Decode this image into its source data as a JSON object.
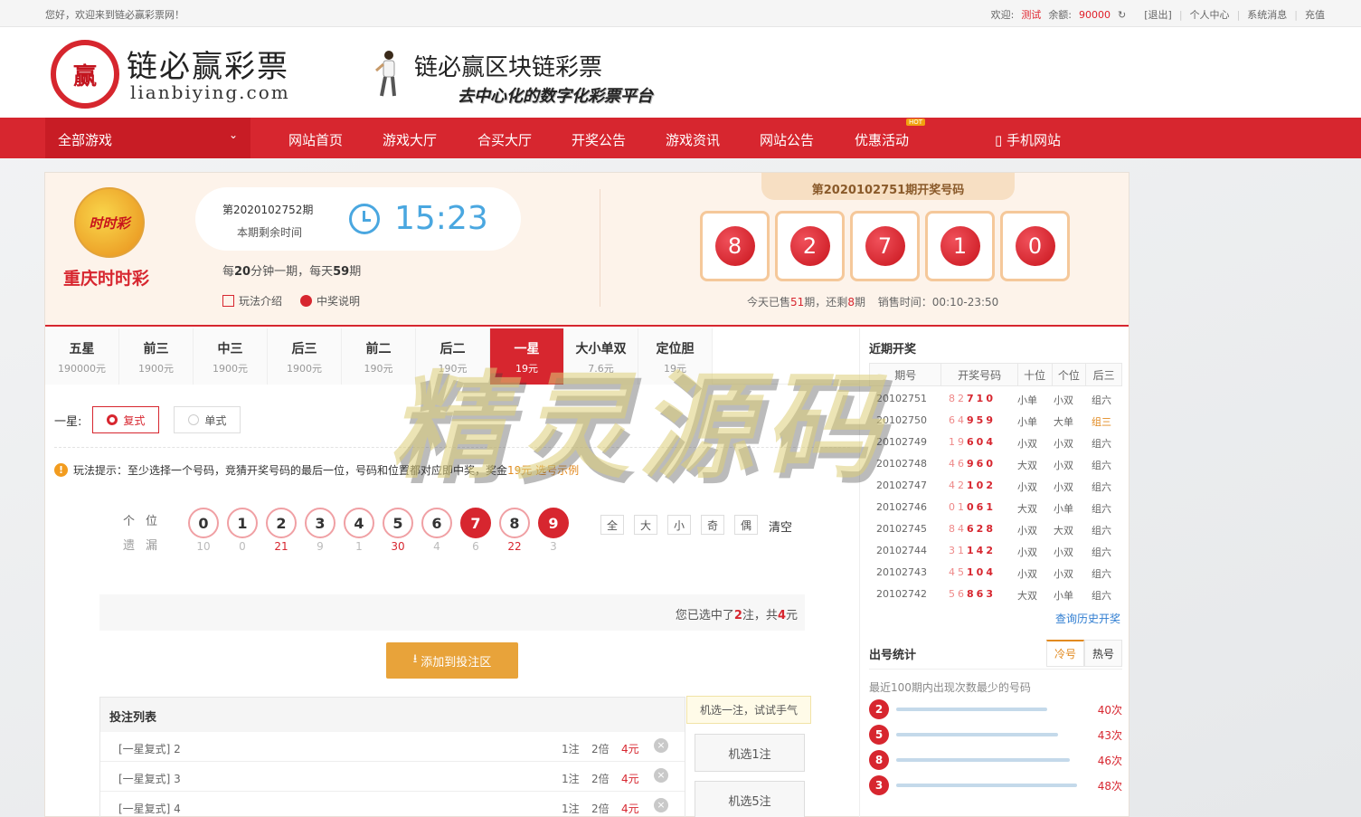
{
  "topbar": {
    "welcome": "您好，欢迎来到链必赢彩票网！",
    "greet_label": "欢迎:",
    "username": "测试",
    "balance_label": "余额:",
    "balance": "90000",
    "logout": "[退出]",
    "personal": "个人中心",
    "messages": "系统消息",
    "recharge": "充值"
  },
  "header": {
    "logo_mark": "赢",
    "logo_cn": "链必赢彩票",
    "logo_en": "lianbiying.com",
    "slogan_title": "链必赢区块链彩票",
    "slogan_sub": "去中心化的数字化彩票平台"
  },
  "nav": {
    "all_games": "全部游戏",
    "items": [
      "网站首页",
      "游戏大厅",
      "合买大厅",
      "开奖公告",
      "游戏资讯",
      "网站公告",
      "优惠活动"
    ],
    "hot": "HOT",
    "mobile": "手机网站"
  },
  "lottery": {
    "logo_text": "时时彩",
    "name": "重庆时时彩",
    "period": "第2020102752期",
    "remain_label": "本期剩余时间",
    "countdown": "15:23",
    "freq_a": "每",
    "freq_min": "20",
    "freq_b": "分钟一期，每天",
    "freq_count": "59",
    "freq_c": "期",
    "rules": "玩法介绍",
    "prize": "中奖说明",
    "draw_title": "第2020102751期开奖号码",
    "draw_balls": [
      "8",
      "2",
      "7",
      "1",
      "0"
    ],
    "sales_a": "今天已售",
    "sold": "51",
    "sales_b": "期，还剩",
    "left": "8",
    "sales_c": "期",
    "sales_time": "销售时间：00:10-23:50"
  },
  "tabs": [
    {
      "title": "五星",
      "prize": "190000元"
    },
    {
      "title": "前三",
      "prize": "1900元"
    },
    {
      "title": "中三",
      "prize": "1900元"
    },
    {
      "title": "后三",
      "prize": "1900元"
    },
    {
      "title": "前二",
      "prize": "190元"
    },
    {
      "title": "后二",
      "prize": "190元"
    },
    {
      "title": "一星",
      "prize": "19元"
    },
    {
      "title": "大小单双",
      "prize": "7.6元"
    },
    {
      "title": "定位胆",
      "prize": "19元"
    }
  ],
  "play": {
    "mode_label": "一星:",
    "mode_fushi": "复式",
    "mode_danshi": "单式",
    "tip_a": "玩法提示：至少选择一个号码，竞猜开奖号码的最后一位，号码和位置都对应即中奖，奖金",
    "tip_amount": "19元",
    "tip_example": "选号示例",
    "pos_label": "个位",
    "miss_label": "遗漏",
    "digits": [
      "0",
      "1",
      "2",
      "3",
      "4",
      "5",
      "6",
      "7",
      "8",
      "9"
    ],
    "misses": [
      "10",
      "0",
      "21",
      "9",
      "1",
      "30",
      "4",
      "6",
      "22",
      "3"
    ],
    "quick": [
      "全",
      "大",
      "小",
      "奇",
      "偶"
    ],
    "clear": "清空",
    "summary_a": "您已选中了",
    "summary_count": "2",
    "summary_b": "注，共",
    "summary_amount": "4",
    "summary_c": "元",
    "add_button": "添加到投注区"
  },
  "betlist": {
    "title": "投注列表",
    "rows": [
      {
        "name": "[一星复式] 2",
        "count": "1注",
        "mult": "2倍",
        "amount": "4元"
      },
      {
        "name": "[一星复式] 3",
        "count": "1注",
        "mult": "2倍",
        "amount": "4元"
      },
      {
        "name": "[一星复式] 4",
        "count": "1注",
        "mult": "2倍",
        "amount": "4元"
      }
    ],
    "try_luck": "机选一注，试试手气",
    "machine1": "机选1注",
    "machine5": "机选5注"
  },
  "recent": {
    "title": "近期开奖",
    "headers": [
      "期号",
      "开奖号码",
      "十位",
      "个位",
      "后三"
    ],
    "rows": [
      {
        "period": "20102751",
        "nums": [
          "8",
          "2",
          "7",
          "1",
          "0"
        ],
        "ten": "小单",
        "one": "小双",
        "last3": "组六"
      },
      {
        "period": "20102750",
        "nums": [
          "6",
          "4",
          "9",
          "5",
          "9"
        ],
        "ten": "小单",
        "one": "大单",
        "last3": "组三"
      },
      {
        "period": "20102749",
        "nums": [
          "1",
          "9",
          "6",
          "0",
          "4"
        ],
        "ten": "小双",
        "one": "小双",
        "last3": "组六"
      },
      {
        "period": "20102748",
        "nums": [
          "4",
          "6",
          "9",
          "6",
          "0"
        ],
        "ten": "大双",
        "one": "小双",
        "last3": "组六"
      },
      {
        "period": "20102747",
        "nums": [
          "4",
          "2",
          "1",
          "0",
          "2"
        ],
        "ten": "小双",
        "one": "小双",
        "last3": "组六"
      },
      {
        "period": "20102746",
        "nums": [
          "0",
          "1",
          "0",
          "6",
          "1"
        ],
        "ten": "大双",
        "one": "小单",
        "last3": "组六"
      },
      {
        "period": "20102745",
        "nums": [
          "8",
          "4",
          "6",
          "2",
          "8"
        ],
        "ten": "小双",
        "one": "大双",
        "last3": "组六"
      },
      {
        "period": "20102744",
        "nums": [
          "3",
          "1",
          "1",
          "4",
          "2"
        ],
        "ten": "小双",
        "one": "小双",
        "last3": "组六"
      },
      {
        "period": "20102743",
        "nums": [
          "4",
          "5",
          "1",
          "0",
          "4"
        ],
        "ten": "小双",
        "one": "小双",
        "last3": "组六"
      },
      {
        "period": "20102742",
        "nums": [
          "5",
          "6",
          "8",
          "6",
          "3"
        ],
        "ten": "大双",
        "one": "小单",
        "last3": "组六"
      }
    ],
    "history_link": "查询历史开奖"
  },
  "stats": {
    "title": "出号统计",
    "tab_cold": "冷号",
    "tab_hot": "热号",
    "desc": "最近100期内出现次数最少的号码",
    "rows": [
      {
        "num": "2",
        "count": "40次",
        "value": 40
      },
      {
        "num": "5",
        "count": "43次",
        "value": 43
      },
      {
        "num": "8",
        "count": "46次",
        "value": 46
      },
      {
        "num": "3",
        "count": "48次",
        "value": 48
      }
    ]
  },
  "watermark": "精灵源码",
  "colors": {
    "brand_red": "#d7262f",
    "accent_blue": "#4aa7e0",
    "accent_orange": "#e8a33a"
  }
}
